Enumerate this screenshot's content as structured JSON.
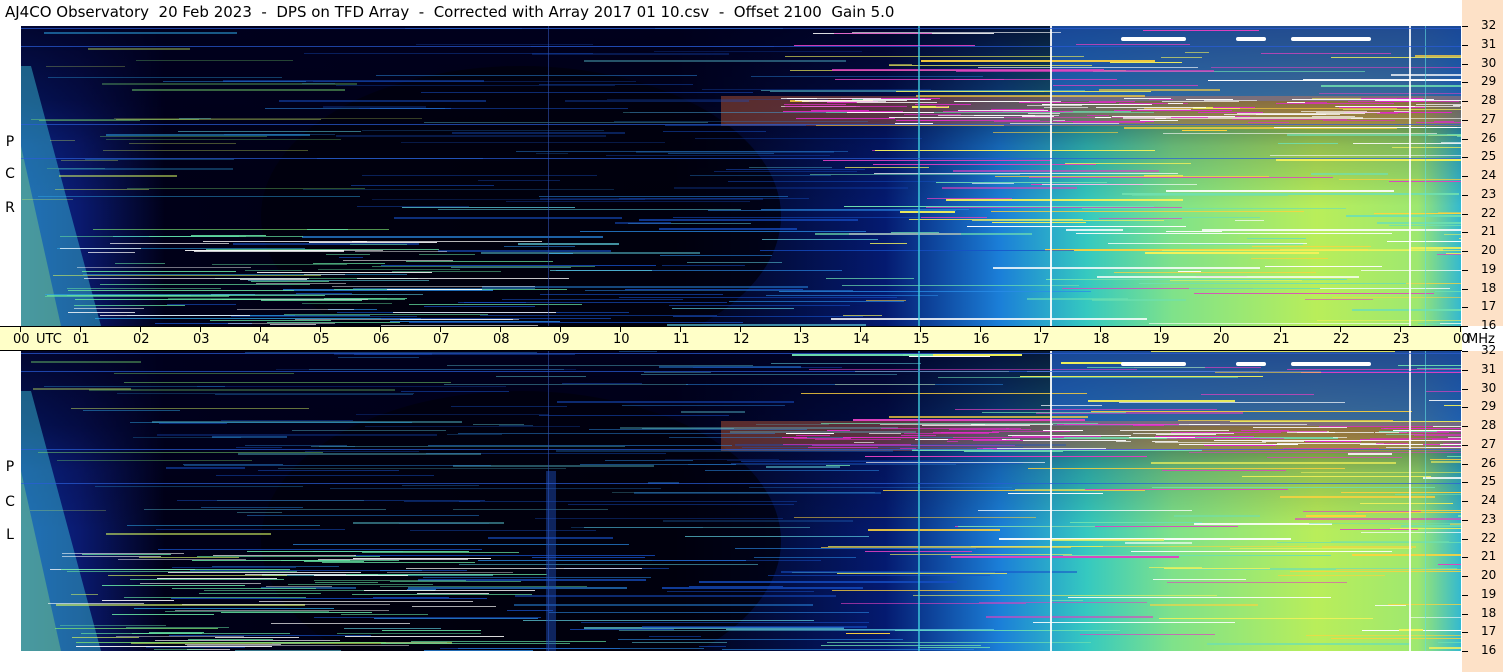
{
  "header": {
    "title": "AJ4CO Observatory  20 Feb 2023  -  DPS on TFD Array  -  Corrected with Array 2017 01 10.csv  -  Offset 2100  Gain 5.0"
  },
  "panels": [
    {
      "id": "rcp",
      "letters": [
        "R",
        "C",
        "P"
      ]
    },
    {
      "id": "lcp",
      "letters": [
        "L",
        "C",
        "P"
      ]
    }
  ],
  "time_axis": {
    "labels": [
      "00",
      "01",
      "02",
      "03",
      "04",
      "05",
      "06",
      "07",
      "08",
      "09",
      "10",
      "11",
      "12",
      "13",
      "14",
      "15",
      "16",
      "17",
      "18",
      "19",
      "20",
      "21",
      "22",
      "23",
      "00"
    ],
    "utc_label": "UTC",
    "unit_label": "MHz"
  },
  "colors": {
    "background": "#000010",
    "time_axis_bg": "#ffffc8",
    "freq_axis_bg": "#fde1c7"
  },
  "chart_data": {
    "type": "heatmap",
    "title": "AJ4CO Observatory  20 Feb 2023  -  DPS on TFD Array  -  Corrected with Array 2017 01 10.csv  -  Offset 2100  Gain 5.0",
    "xlabel": "UTC",
    "ylabel": "MHz",
    "x_range": [
      0,
      24
    ],
    "y_range": [
      16,
      32
    ],
    "y_ticks": [
      16,
      17,
      18,
      19,
      20,
      21,
      22,
      23,
      24,
      25,
      26,
      27,
      28,
      29,
      30,
      31,
      32
    ],
    "panels": [
      "RCP",
      "LCP"
    ]
  }
}
